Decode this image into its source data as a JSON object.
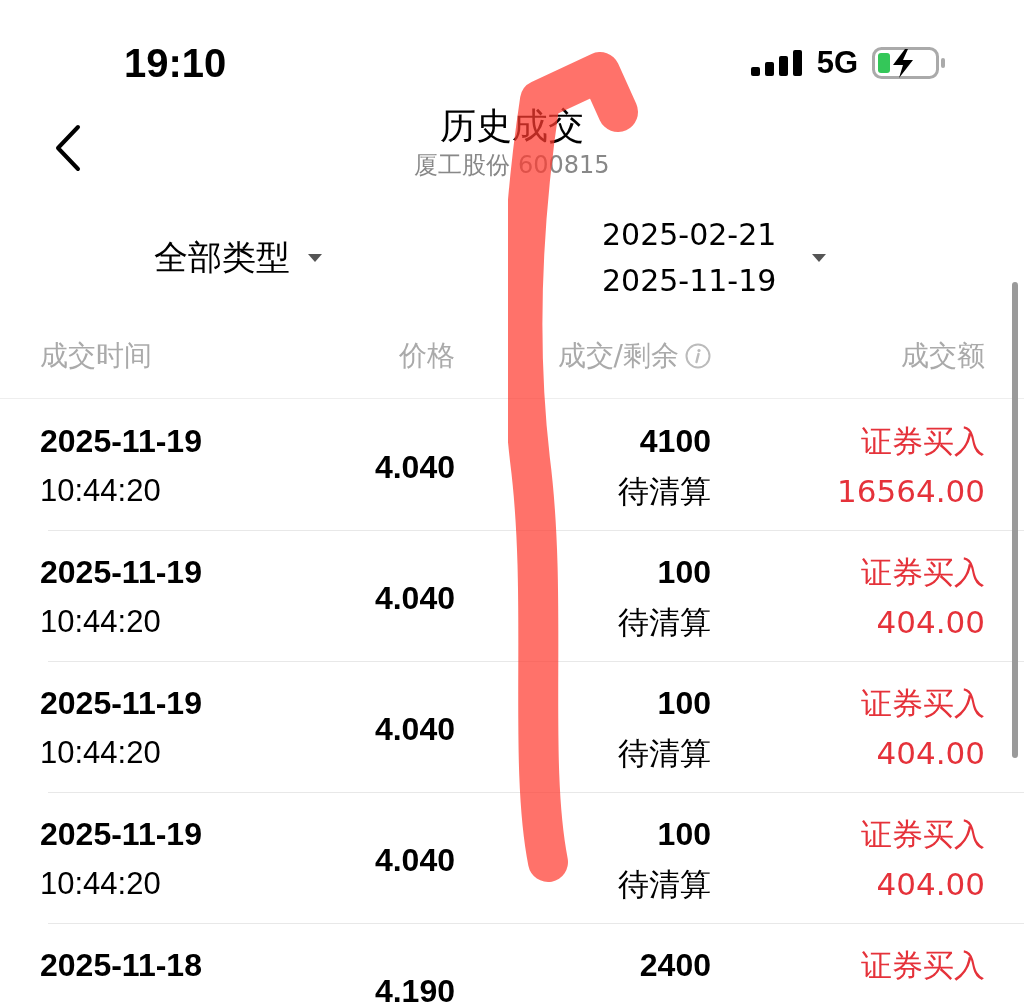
{
  "status_bar": {
    "time": "19:10",
    "network": "5G"
  },
  "header": {
    "title": "历史成交",
    "subtitle": "厦工股份 600815"
  },
  "filters": {
    "type": "全部类型",
    "date_from": "2025-02-21",
    "date_to": "2025-11-19"
  },
  "table": {
    "columns": [
      "成交时间",
      "价格",
      "成交/剩余",
      "成交额"
    ],
    "rows": [
      {
        "date": "2025-11-19",
        "time": "10:44:20",
        "price": "4.040",
        "quantity": "4100",
        "status": "待清算",
        "type": "证券买入",
        "amount": "16564.00"
      },
      {
        "date": "2025-11-19",
        "time": "10:44:20",
        "price": "4.040",
        "quantity": "100",
        "status": "待清算",
        "type": "证券买入",
        "amount": "404.00"
      },
      {
        "date": "2025-11-19",
        "time": "10:44:20",
        "price": "4.040",
        "quantity": "100",
        "status": "待清算",
        "type": "证券买入",
        "amount": "404.00"
      },
      {
        "date": "2025-11-19",
        "time": "10:44:20",
        "price": "4.040",
        "quantity": "100",
        "status": "待清算",
        "type": "证券买入",
        "amount": "404.00"
      },
      {
        "date": "2025-11-18",
        "price": "4.190",
        "quantity": "2400",
        "type": "证券买入"
      }
    ]
  }
}
